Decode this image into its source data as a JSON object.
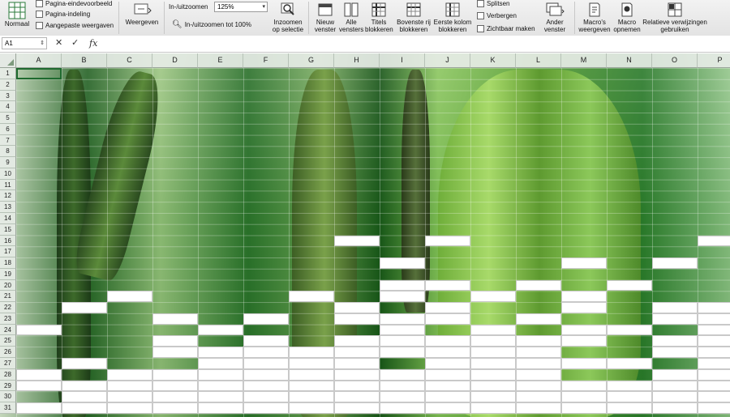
{
  "ribbon": {
    "normal_label": "Normaal",
    "page_break_preview": "Pagina-eindevoorbeeld",
    "page_layout": "Pagina-indeling",
    "custom_views": "Aangepaste weergaven",
    "views_label": "Weergeven",
    "zoom_label": "In-/uitzoomen",
    "zoom_value": "125%",
    "zoom_100": "In-/uitzoomen tot 100%",
    "zoom_selection": "Inzoomen op selectie",
    "new_window": "Nieuw venster",
    "arrange_all": "Alle vensters",
    "freeze_panes": "Titels blokkeren",
    "freeze_top_row": "Bovenste rij blokkeren",
    "freeze_first_col": "Eerste kolom blokkeren",
    "split": "Splitsen",
    "hide": "Verbergen",
    "unhide": "Zichtbaar maken",
    "switch_window": "Ander venster",
    "view_macros": "Macro's weergeven",
    "record_macro": "Macro opnemen",
    "relative_refs": "Relatieve verwijzingen gebruiken"
  },
  "formula_bar": {
    "name_box": "A1",
    "cancel_icon": "✕",
    "confirm_icon": "✓",
    "fx_icon": "fx",
    "formula": ""
  },
  "grid": {
    "columns": [
      "A",
      "B",
      "C",
      "D",
      "E",
      "F",
      "G",
      "H",
      "I",
      "J",
      "K",
      "L",
      "M",
      "N",
      "O",
      "P"
    ],
    "rows": [
      "1",
      "2",
      "3",
      "4",
      "5",
      "6",
      "7",
      "8",
      "9",
      "10",
      "11",
      "12",
      "13",
      "14",
      "15",
      "16",
      "17",
      "18",
      "19",
      "20",
      "21",
      "22",
      "23",
      "24",
      "25",
      "26",
      "27",
      "28",
      "29",
      "30",
      "31"
    ],
    "white_cells": [
      [
        "H",
        16
      ],
      [
        "J",
        16
      ],
      [
        "P",
        16
      ],
      [
        "I",
        18
      ],
      [
        "M",
        18
      ],
      [
        "O",
        18
      ],
      [
        "I",
        20
      ],
      [
        "J",
        20
      ],
      [
        "L",
        20
      ],
      [
        "N",
        20
      ],
      [
        "C",
        21
      ],
      [
        "G",
        21
      ],
      [
        "I",
        21
      ],
      [
        "K",
        21
      ],
      [
        "M",
        21
      ],
      [
        "B",
        22
      ],
      [
        "H",
        22
      ],
      [
        "J",
        22
      ],
      [
        "M",
        22
      ],
      [
        "O",
        22
      ],
      [
        "P",
        22
      ],
      [
        "D",
        23
      ],
      [
        "F",
        23
      ],
      [
        "H",
        23
      ],
      [
        "I",
        23
      ],
      [
        "J",
        23
      ],
      [
        "L",
        23
      ],
      [
        "O",
        23
      ],
      [
        "P",
        23
      ],
      [
        "A",
        24
      ],
      [
        "E",
        24
      ],
      [
        "I",
        24
      ],
      [
        "K",
        24
      ],
      [
        "M",
        24
      ],
      [
        "N",
        24
      ],
      [
        "P",
        24
      ],
      [
        "D",
        25
      ],
      [
        "F",
        25
      ],
      [
        "H",
        25
      ],
      [
        "I",
        25
      ],
      [
        "J",
        25
      ],
      [
        "K",
        25
      ],
      [
        "L",
        25
      ],
      [
        "M",
        25
      ],
      [
        "O",
        25
      ],
      [
        "P",
        25
      ],
      [
        "D",
        26
      ],
      [
        "E",
        26
      ],
      [
        "F",
        26
      ],
      [
        "G",
        26
      ],
      [
        "H",
        26
      ],
      [
        "I",
        26
      ],
      [
        "J",
        26
      ],
      [
        "K",
        26
      ],
      [
        "L",
        26
      ],
      [
        "O",
        26
      ],
      [
        "P",
        26
      ],
      [
        "B",
        27
      ],
      [
        "E",
        27
      ],
      [
        "F",
        27
      ],
      [
        "G",
        27
      ],
      [
        "H",
        27
      ],
      [
        "J",
        27
      ],
      [
        "K",
        27
      ],
      [
        "L",
        27
      ],
      [
        "M",
        27
      ],
      [
        "N",
        27
      ],
      [
        "P",
        27
      ],
      [
        "A",
        28
      ],
      [
        "C",
        28
      ],
      [
        "D",
        28
      ],
      [
        "E",
        28
      ],
      [
        "F",
        28
      ],
      [
        "G",
        28
      ],
      [
        "H",
        28
      ],
      [
        "I",
        28
      ],
      [
        "J",
        28
      ],
      [
        "K",
        28
      ],
      [
        "L",
        28
      ],
      [
        "O",
        28
      ],
      [
        "P",
        28
      ],
      [
        "A",
        29
      ],
      [
        "B",
        29
      ],
      [
        "C",
        29
      ],
      [
        "D",
        29
      ],
      [
        "E",
        29
      ],
      [
        "F",
        29
      ],
      [
        "G",
        29
      ],
      [
        "H",
        29
      ],
      [
        "I",
        29
      ],
      [
        "J",
        29
      ],
      [
        "K",
        29
      ],
      [
        "L",
        29
      ],
      [
        "M",
        29
      ],
      [
        "N",
        29
      ],
      [
        "O",
        29
      ],
      [
        "P",
        29
      ],
      [
        "B",
        30
      ],
      [
        "C",
        30
      ],
      [
        "D",
        30
      ],
      [
        "E",
        30
      ],
      [
        "F",
        30
      ],
      [
        "G",
        30
      ],
      [
        "H",
        30
      ],
      [
        "I",
        30
      ],
      [
        "J",
        30
      ],
      [
        "K",
        30
      ],
      [
        "L",
        30
      ],
      [
        "M",
        30
      ],
      [
        "N",
        30
      ],
      [
        "O",
        30
      ],
      [
        "P",
        30
      ],
      [
        "A",
        31
      ],
      [
        "B",
        31
      ],
      [
        "C",
        31
      ],
      [
        "D",
        31
      ],
      [
        "E",
        31
      ],
      [
        "F",
        31
      ],
      [
        "G",
        31
      ],
      [
        "H",
        31
      ],
      [
        "I",
        31
      ],
      [
        "J",
        31
      ],
      [
        "K",
        31
      ],
      [
        "L",
        31
      ],
      [
        "M",
        31
      ],
      [
        "N",
        31
      ],
      [
        "O",
        31
      ],
      [
        "P",
        31
      ]
    ]
  },
  "colors": {
    "accent": "#1f6a2f",
    "header_bg": "#e6ece6",
    "forest_dark": "#1f5f1f",
    "forest_light": "#8cc85a"
  }
}
